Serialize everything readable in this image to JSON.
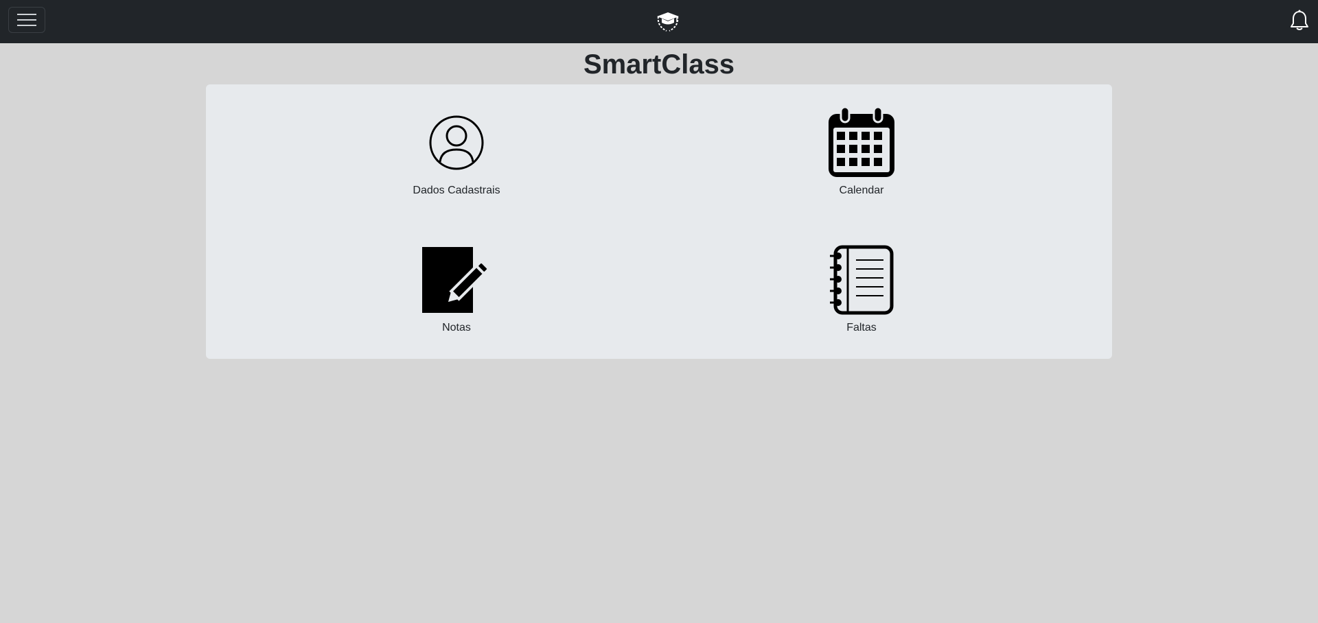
{
  "header": {
    "menu_icon": "hamburger-menu-icon",
    "logo_icon": "graduation-cap-logo-icon",
    "notification_icon": "bell-icon"
  },
  "page": {
    "title": "SmartClass"
  },
  "tiles": [
    {
      "label": "Dados Cadastrais",
      "icon": "user-circle-icon"
    },
    {
      "label": "Calendar",
      "icon": "calendar-icon"
    },
    {
      "label": "Notas",
      "icon": "pencil-square-icon"
    },
    {
      "label": "Faltas",
      "icon": "notebook-icon"
    }
  ],
  "colors": {
    "navbar": "#212529",
    "background": "#d6d6d6",
    "panel": "#e7eaed"
  }
}
